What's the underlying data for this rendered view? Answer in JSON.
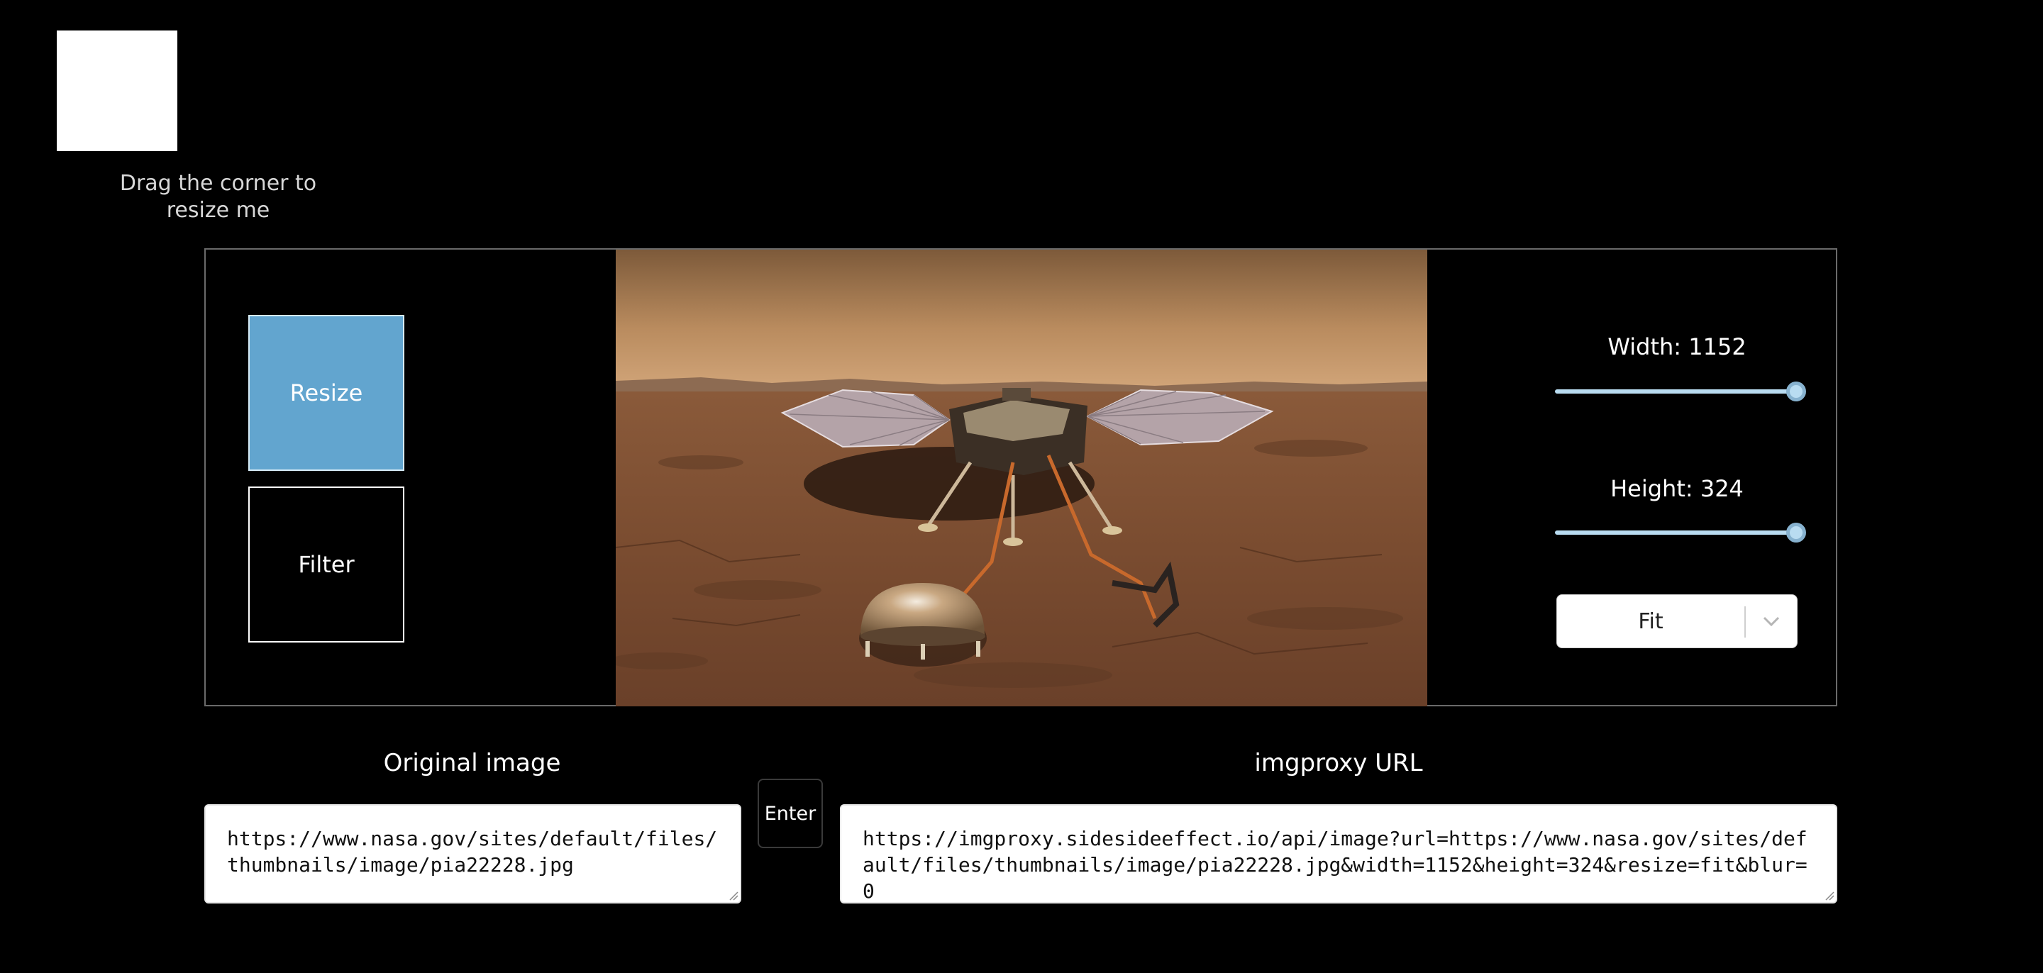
{
  "resize_demo": {
    "caption": "Drag the corner to resize me"
  },
  "modes": {
    "resize_label": "Resize",
    "filter_label": "Filter",
    "active": "Resize"
  },
  "controls": {
    "width_label": "Width: 1152",
    "height_label": "Height: 324",
    "width_value": 1152,
    "height_value": 324,
    "width_fraction": 1.0,
    "height_fraction": 1.0,
    "fit_select": {
      "selected": "Fit"
    }
  },
  "original": {
    "title": "Original image",
    "url": "https://www.nasa.gov/sites/default/files/thumbnails/image/pia22228.jpg"
  },
  "enter_label": "Enter",
  "imgproxy": {
    "title": "imgproxy URL",
    "url": "https://imgproxy.sidesideeffect.io/api/image?url=https://www.nasa.gov/sites/default/files/thumbnails/image/pia22228.jpg&width=1152&height=324&resize=fit&blur=0"
  },
  "colors": {
    "accent": "#62a5cf",
    "slider": "#b9dcf1",
    "background": "#000000"
  }
}
